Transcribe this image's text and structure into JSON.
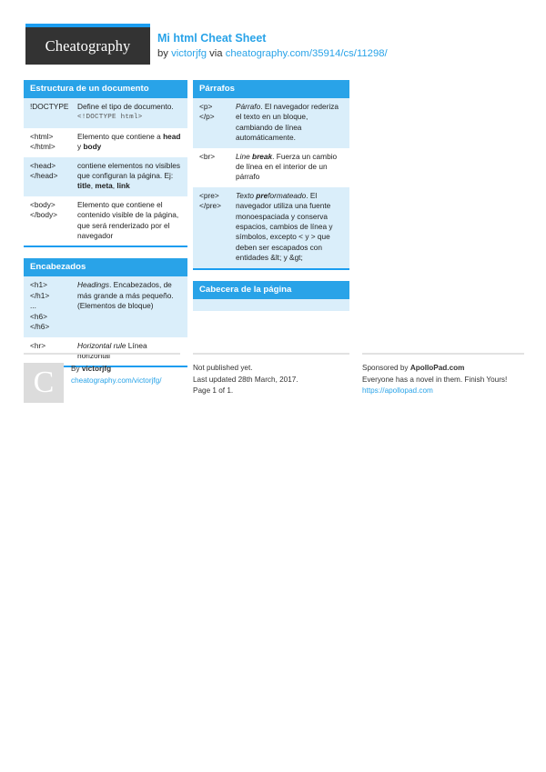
{
  "header": {
    "logo_text": "Cheatography",
    "title": "Mi html Cheat Sheet",
    "by_prefix": "by ",
    "author": "victorjfg",
    "via": " via ",
    "source_url": "cheatography.com/35914/cs/11298/"
  },
  "left_column": [
    {
      "title": "Estructura de un documento",
      "rows": [
        {
          "key": "!DOCTYPE",
          "value": "Define el tipo de documento.",
          "code": "<!DOCTYPE html>"
        },
        {
          "key": "<html>\n</html>",
          "value": "Elemento que contiene a <b>head</b> y <b>body</b>"
        },
        {
          "key": "<head>\n</head>",
          "value": "contiene elementos no visibles que configuran la página. Ej: <b>title</b>, <b>meta</b>, <b>link</b>"
        },
        {
          "key": "<body>\n</body>",
          "value": "Elemento que contiene el contenido visible de la página, que será renderizado por el navegador"
        }
      ]
    },
    {
      "title": "Encabezados",
      "rows": [
        {
          "key": "<h1>\n</h1>\n...\n<h6>\n</h6>",
          "value": "<i>Headings</i>. Encabezados, de más grande a más pequeño. (Elementos de bloque)"
        },
        {
          "key": "<hr>",
          "value": "<i>Horizontal rule</i> Línea horizontal"
        }
      ]
    }
  ],
  "right_column": [
    {
      "title": "Párrafos",
      "rows": [
        {
          "key": "<p>\n</p>",
          "value": "<i>Párrafo</i>. El navegador rederiza el texto en un bloque, cambiando de línea automáticamente."
        },
        {
          "key": "<br>",
          "value": "<i>Line <b>break</b></i>. Fuerza un cambio de línea en el interior de un párrafo"
        },
        {
          "key": "<pre>\n</pre>",
          "value": "<i>Texto <b>pre</b>formateado</i>. El navegador utiliza una fuente monoespaciada y conserva espacios, cambios de línea y símbolos, excepto &lt; y &gt; que deben ser escapados con entidades &amp;lt; y &amp;gt;"
        }
      ]
    },
    {
      "title": "Cabecera de la página",
      "rows": []
    }
  ],
  "footer": {
    "avatar_letter": "C",
    "by_label": "By ",
    "author": "victorjfg",
    "author_url": "cheatography.com/victorjfg/",
    "publish_status": "Not published yet.",
    "last_updated": "Last updated 28th March, 2017.",
    "page_info": "Page 1 of 1.",
    "sponsor_prefix": "Sponsored by ",
    "sponsor_name": "ApolloPad.com",
    "sponsor_tagline": "Everyone has a novel in them. Finish Yours!",
    "sponsor_url": "https://apollopad.com"
  },
  "colors": {
    "accent": "#29a3e8",
    "accent_dark": "#1b9df0",
    "row_alt": "#daeefa",
    "logo_bg": "#333333"
  }
}
